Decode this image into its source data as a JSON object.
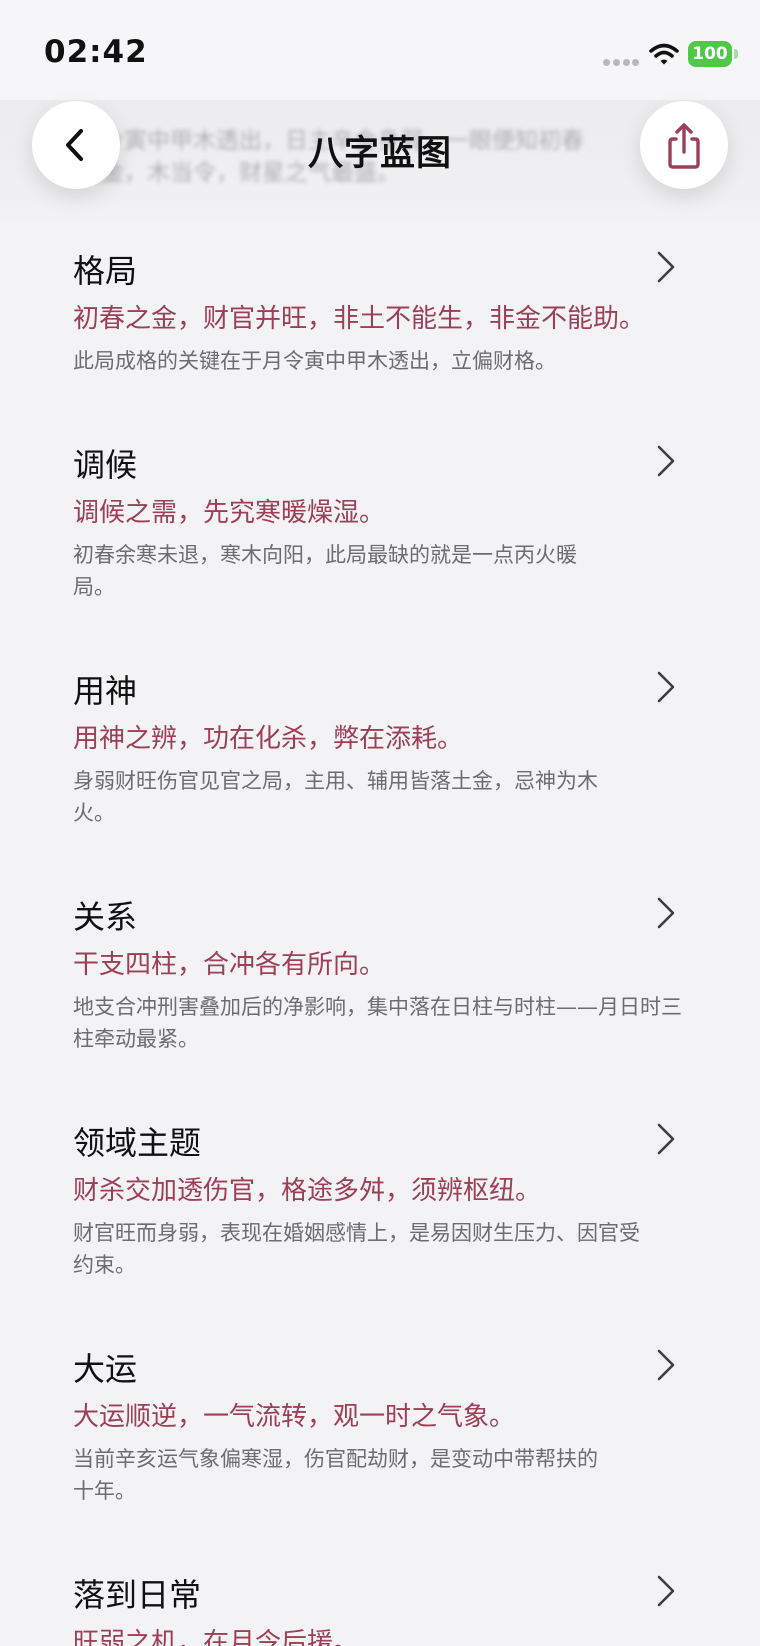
{
  "status_bar": {
    "time": "02:42",
    "battery": "100"
  },
  "nav": {
    "title": "八字蓝图",
    "ghost_line_1": "月令寅中甲木透出，日主辛金身弱，一眼便知初春",
    "ghost_line_2": "之金，木当令，财星之气最盛。"
  },
  "sections": [
    {
      "title": "格局",
      "subtitle": "初春之金，财官并旺，非土不能生，非金不能助。",
      "body": "此局成格的关键在于月令寅中甲木透出，立偏财格。"
    },
    {
      "title": "调候",
      "subtitle": "调候之需，先究寒暖燥湿。",
      "body": "初春余寒未退，寒木向阳，此局最缺的就是一点丙火暖局。"
    },
    {
      "title": "用神",
      "subtitle": "用神之辨，功在化杀，弊在添耗。",
      "body": "身弱财旺伤官见官之局，主用、辅用皆落土金，忌神为木火。"
    },
    {
      "title": "关系",
      "subtitle": "干支四柱，合冲各有所向。",
      "body": "地支合冲刑害叠加后的净影响，集中落在日柱与时柱——月日时三柱牵动最紧。"
    },
    {
      "title": "领域主题",
      "subtitle": "财杀交加透伤官，格途多舛，须辨枢纽。",
      "body": "财官旺而身弱，表现在婚姻感情上，是易因财生压力、因官受约束。"
    },
    {
      "title": "大运",
      "subtitle": "大运顺逆，一气流转，观一时之气象。",
      "body": "当前辛亥运气象偏寒湿，伤官配劫财，是变动中带帮扶的十年。"
    },
    {
      "title": "落到日常",
      "subtitle": "旺弱之机，在月令后援。",
      "body": ""
    }
  ],
  "colors": {
    "accent": "#9b4055",
    "background": "#f3f3f6",
    "battery": "#4fc84a"
  },
  "icons": {
    "back": "chevron-left-icon",
    "share": "share-icon",
    "row": "chevron-right-icon"
  }
}
